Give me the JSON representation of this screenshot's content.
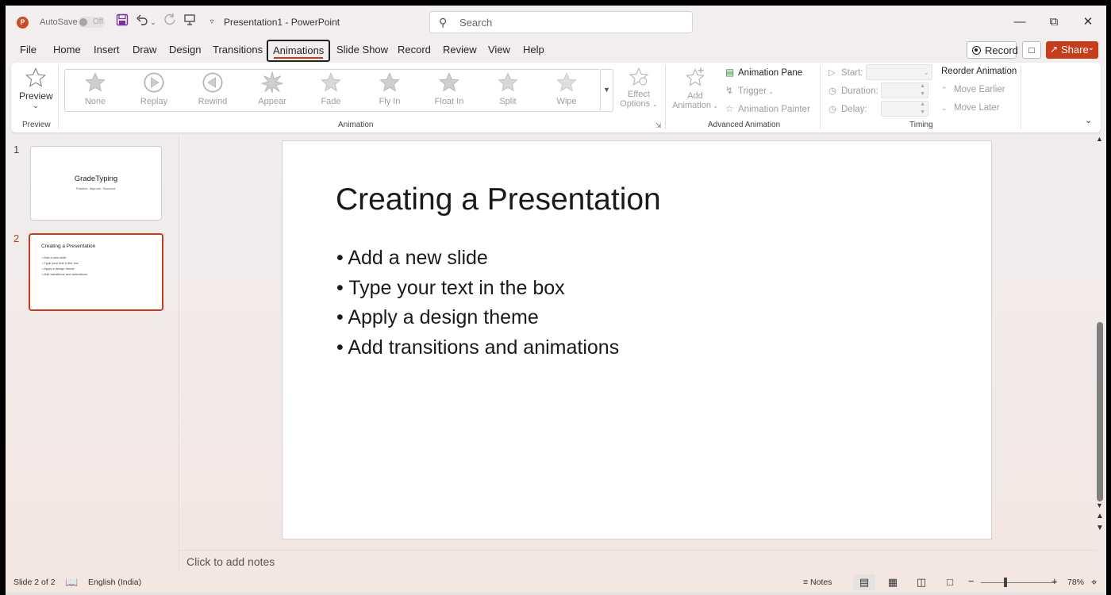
{
  "titlebar": {
    "autosave_label": "AutoSave",
    "autosave_state": "Off",
    "doc_title": "Presentation1  -  PowerPoint",
    "search_placeholder": "Search"
  },
  "tabs": [
    "File",
    "Home",
    "Insert",
    "Draw",
    "Design",
    "Transitions",
    "Animations",
    "Slide Show",
    "Record",
    "Review",
    "View",
    "Help"
  ],
  "active_tab": "Animations",
  "right_buttons": {
    "record": "Record",
    "share": "Share"
  },
  "ribbon": {
    "preview": {
      "button": "Preview",
      "group": "Preview"
    },
    "animation": {
      "group": "Animation",
      "gallery": [
        "None",
        "Replay",
        "Rewind",
        "Appear",
        "Fade",
        "Fly In",
        "Float In",
        "Split",
        "Wipe"
      ],
      "effect_options_line1": "Effect",
      "effect_options_line2": "Options"
    },
    "advanced": {
      "group": "Advanced Animation",
      "add_line1": "Add",
      "add_line2": "Animation",
      "pane": "Animation Pane",
      "trigger": "Trigger",
      "painter": "Animation Painter"
    },
    "timing": {
      "group": "Timing",
      "start": "Start:",
      "duration": "Duration:",
      "delay": "Delay:",
      "reorder": "Reorder Animation",
      "move_earlier": "Move Earlier",
      "move_later": "Move Later"
    }
  },
  "thumbnails": [
    {
      "num": "1",
      "title": "GradeTyping",
      "subtitle": "Practice. Improve. Succeed."
    },
    {
      "num": "2",
      "title": "Creating a Presentation",
      "bullets": [
        "• Add a new slide",
        "• Type your text in the box",
        "• Apply a design theme",
        "• Add transitions and animations"
      ]
    }
  ],
  "slide": {
    "title": "Creating a Presentation",
    "bullets": [
      "• Add a new slide",
      "• Type your text in the box",
      "• Apply a design theme",
      "• Add transitions and animations"
    ]
  },
  "notes_placeholder": "Click to add notes",
  "status": {
    "slide_info": "Slide 2 of 2",
    "language": "English (India)",
    "notes": "Notes",
    "zoom": "78%"
  },
  "colors": {
    "accent": "#c43e1c",
    "app_icon": "#d24726",
    "qat_icon": "#7b2fa0"
  }
}
